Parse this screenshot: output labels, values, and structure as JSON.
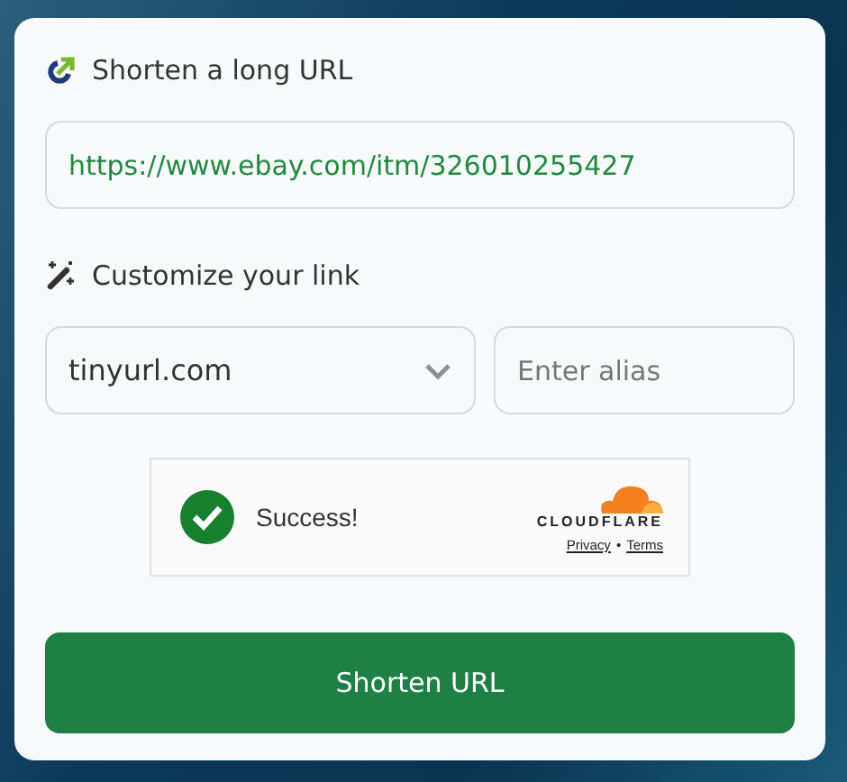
{
  "long_url": {
    "heading": "Shorten a long URL",
    "value": "https://www.ebay.com/itm/326010255427"
  },
  "customize": {
    "heading": "Customize your link",
    "domain": "tinyurl.com",
    "alias_placeholder": "Enter alias"
  },
  "captcha": {
    "status": "Success!",
    "brand": "CLOUDFLARE",
    "links": [
      "Privacy",
      "Terms"
    ],
    "separator": "•"
  },
  "submit_button": "Shorten URL"
}
